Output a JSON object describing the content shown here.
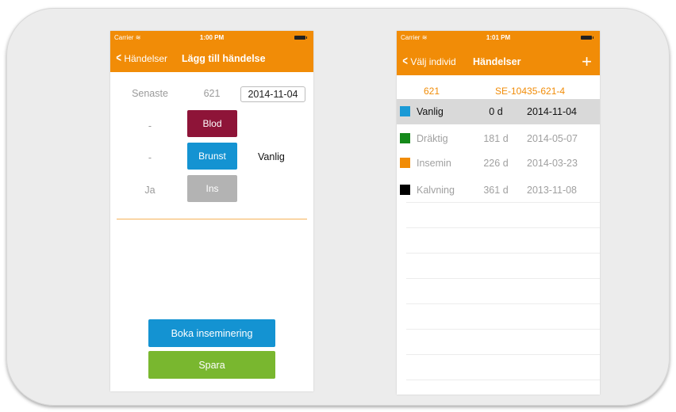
{
  "left": {
    "status": {
      "carrier": "Carrier",
      "time": "1:00 PM"
    },
    "nav": {
      "back": "Händelser",
      "title": "Lägg till händelse"
    },
    "header": {
      "label": "Senaste",
      "number": "621",
      "date": "2014-11-04"
    },
    "events": [
      {
        "left": "-",
        "label": "Blod",
        "color": "#8e1438"
      },
      {
        "left": "-",
        "label": "Brunst",
        "color": "#1493d2",
        "right": "Vanlig"
      },
      {
        "left": "Ja",
        "label": "Ins",
        "color": "#b3b3b3"
      }
    ],
    "book_button": "Boka inseminering",
    "save_button": "Spara"
  },
  "right": {
    "status": {
      "carrier": "Carrier",
      "time": "1:01 PM"
    },
    "nav": {
      "back": "Välj individ",
      "title": "Händelser",
      "add": "+"
    },
    "header": {
      "number": "621",
      "id": "SE-10435-621-4"
    },
    "rows": [
      {
        "name": "Vanlig",
        "days": "0 d",
        "date": "2014-11-04",
        "color": "#1a9ad6"
      },
      {
        "name": "Dräktig",
        "days": "181 d",
        "date": "2014-05-07",
        "color": "#15891a"
      },
      {
        "name": "Insemin",
        "days": "226 d",
        "date": "2014-03-23",
        "color": "#f18c07"
      },
      {
        "name": "Kalvning",
        "days": "361 d",
        "date": "2013-11-08",
        "color": "#000000"
      }
    ]
  },
  "colors": {
    "accent": "#f18c07",
    "book": "#1493d2",
    "save": "#79b72f"
  }
}
